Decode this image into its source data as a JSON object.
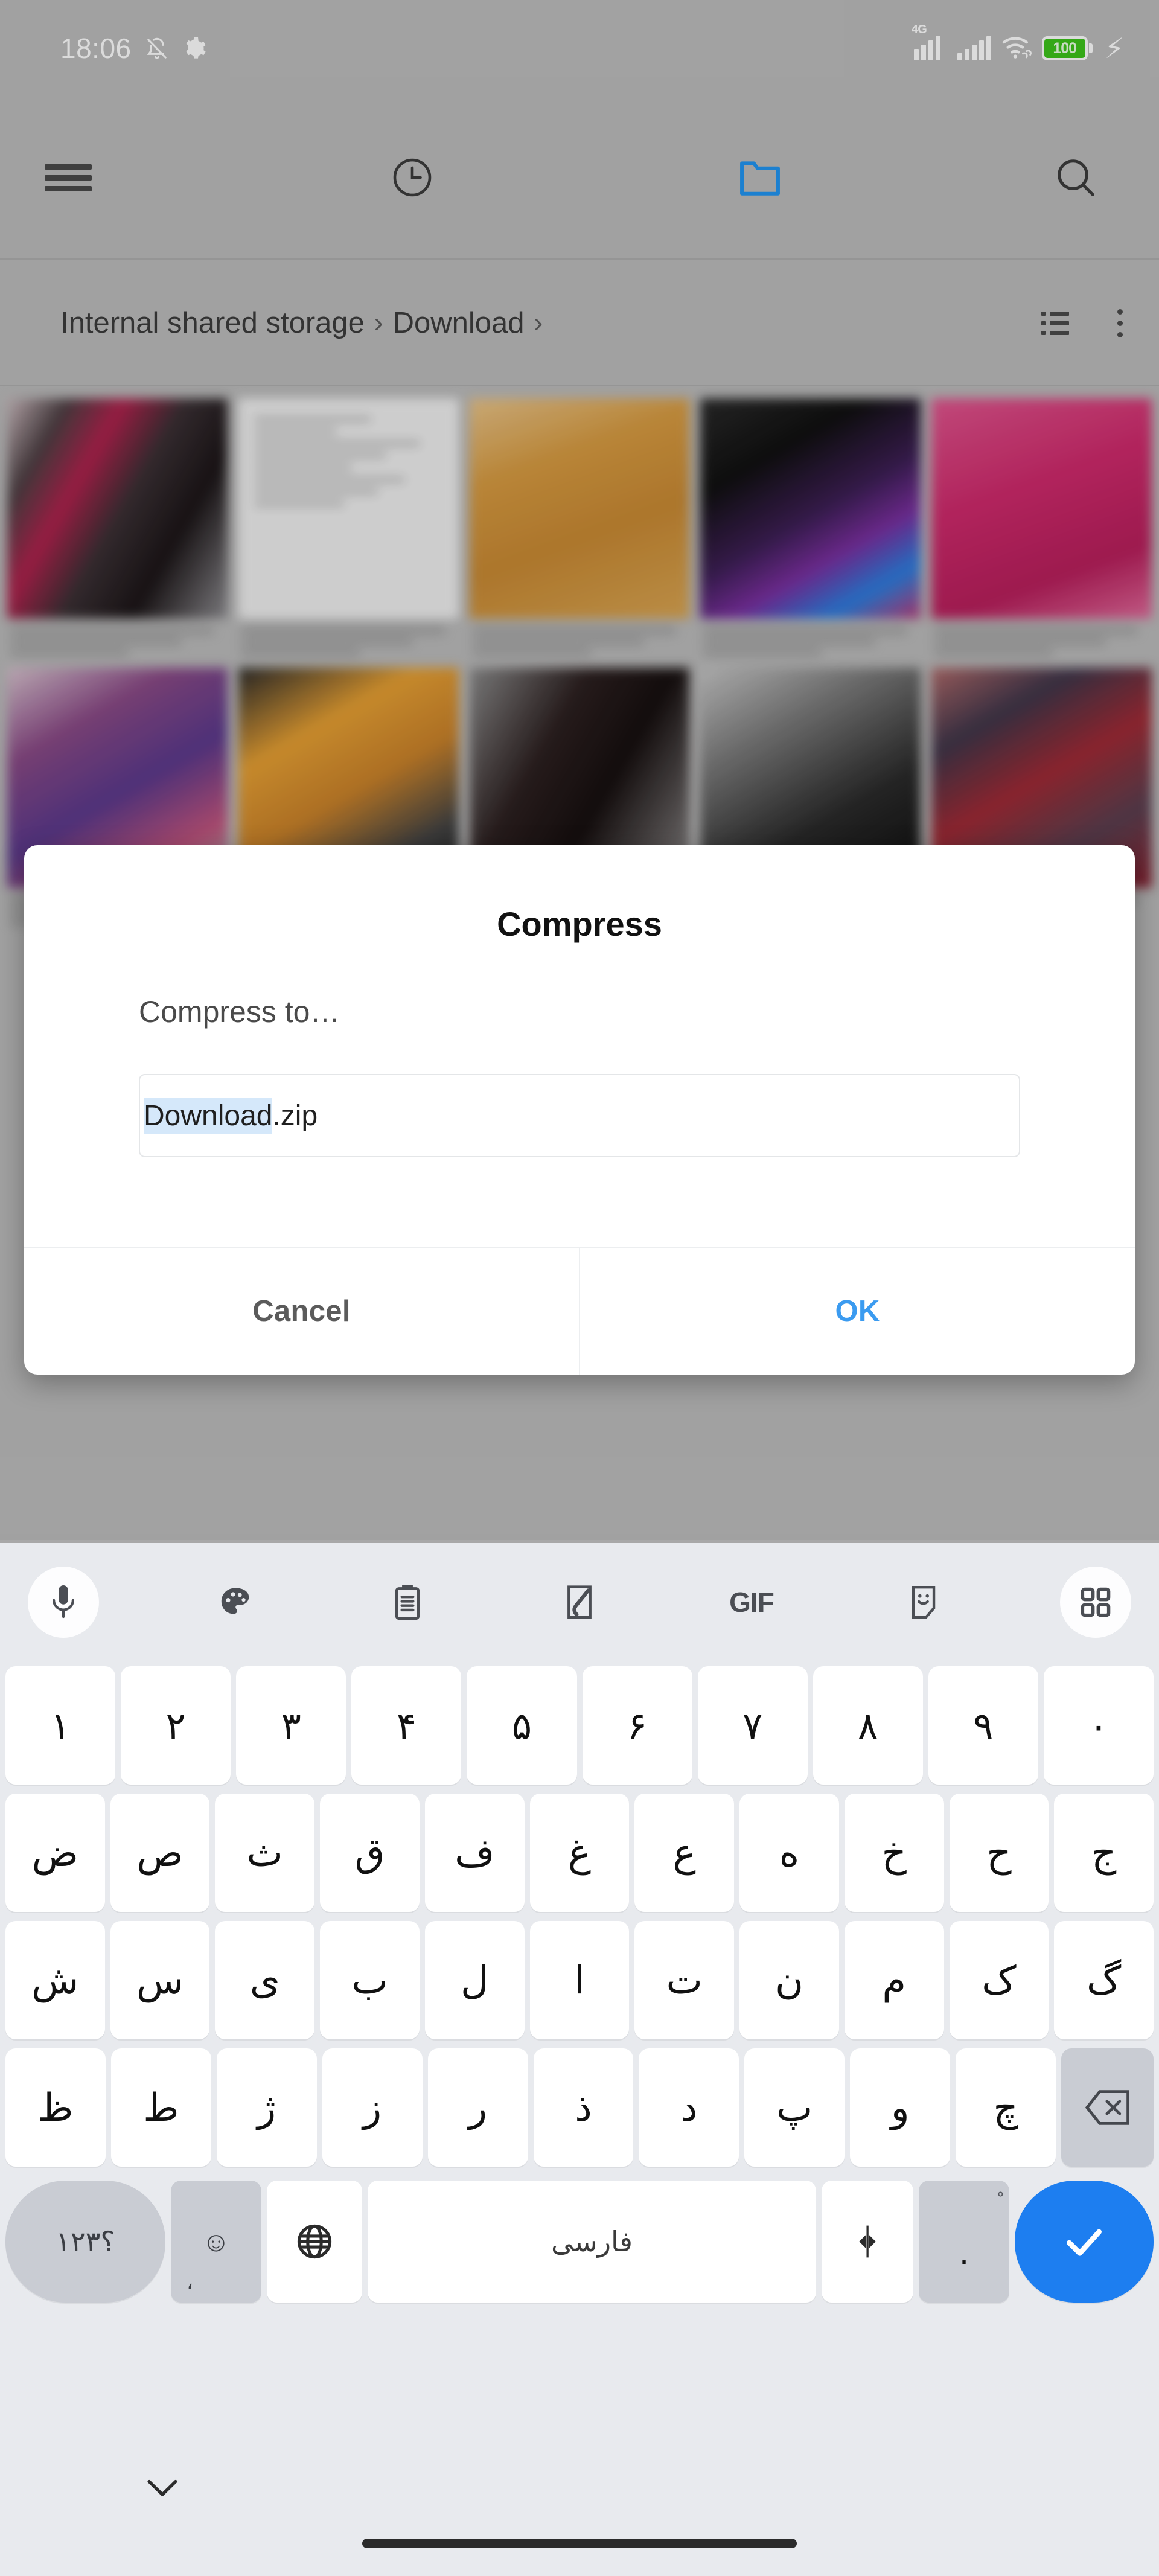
{
  "status_bar": {
    "time": "18:06",
    "icons_left": [
      "bell-off-icon",
      "gear-icon"
    ],
    "network_label": "4G",
    "battery_percent": "100",
    "icons_right": [
      "signal-4g-icon",
      "signal-icon",
      "wifi-icon",
      "battery-icon",
      "charging-bolt-icon"
    ]
  },
  "app_toolbar": {
    "menu_icon": "hamburger-menu-icon",
    "recent_icon": "clock-icon",
    "storage_icon": "folder-icon",
    "search_icon": "search-icon",
    "active_tab": "folder"
  },
  "breadcrumb": {
    "items": [
      "Internal shared storage",
      "Download"
    ],
    "separator": "›",
    "view_toggle_icon": "list-view-icon",
    "overflow_icon": "kebab-menu-icon"
  },
  "dialog": {
    "title": "Compress",
    "label": "Compress to…",
    "input": {
      "value": "Download.zip",
      "selected_part": "Download",
      "unselected_part": ".zip"
    },
    "buttons": {
      "cancel": "Cancel",
      "ok": "OK"
    },
    "ok_color": "#3b9bf0",
    "cancel_color": "#5b5b5b"
  },
  "keyboard": {
    "language": "فارسی",
    "toolbar": [
      {
        "name": "microphone-icon",
        "label": ""
      },
      {
        "name": "palette-icon",
        "label": ""
      },
      {
        "name": "clipboard-icon",
        "label": ""
      },
      {
        "name": "handwriting-icon",
        "label": ""
      },
      {
        "name": "gif-icon",
        "label": "GIF"
      },
      {
        "name": "sticker-icon",
        "label": ""
      },
      {
        "name": "apps-grid-icon",
        "label": ""
      }
    ],
    "rows": [
      [
        "۱",
        "۲",
        "۳",
        "۴",
        "۵",
        "۶",
        "۷",
        "۸",
        "۹",
        "۰"
      ],
      [
        "ض",
        "ص",
        "ث",
        "ق",
        "ف",
        "غ",
        "ع",
        "ه",
        "خ",
        "ح",
        "ج"
      ],
      [
        "ش",
        "س",
        "ی",
        "ب",
        "ل",
        "ا",
        "ت",
        "ن",
        "م",
        "ک",
        "گ"
      ],
      [
        "ظ",
        "ط",
        "ژ",
        "ز",
        "ر",
        "ذ",
        "د",
        "پ",
        "و",
        "چ"
      ]
    ],
    "backspace_label": "backspace-key",
    "bottom_row": {
      "symbols_label": "۱۲۳؟",
      "emoji_label": "emoji-key",
      "emoji_sub": "،",
      "globe_label": "globe-key",
      "space_label": "فارسی",
      "cursor_label": "cursor-keys",
      "period_label": ".",
      "period_sup": "ْ",
      "enter_label": "enter-key"
    },
    "enter_color": "#1d7ef0",
    "hide_keyboard_icon": "chevron-down-icon",
    "home_indicator": "home-gesture-bar"
  }
}
